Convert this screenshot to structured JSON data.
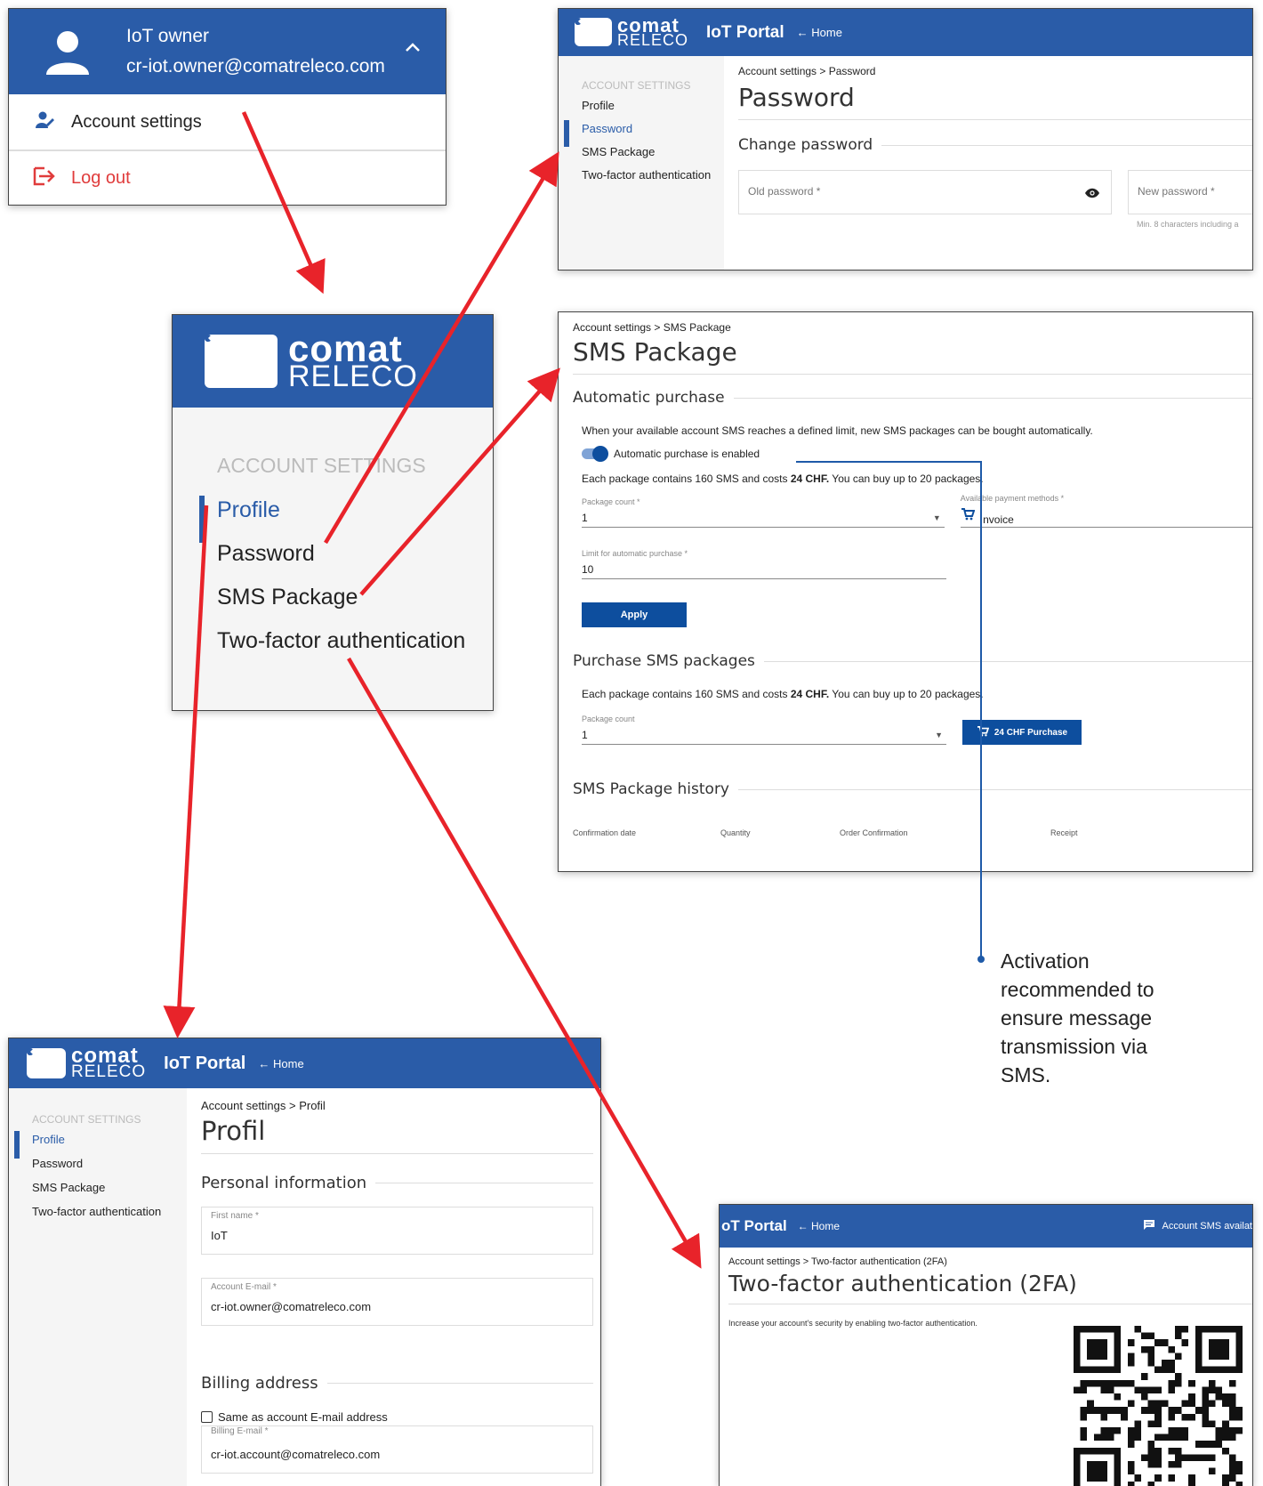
{
  "user_menu": {
    "user_name": "IoT owner",
    "user_email": "cr-iot.owner@comatreleco.com",
    "account_settings_label": "Account settings",
    "logout_label": "Log out"
  },
  "logo": {
    "line1": "comat",
    "line2": "RELECO"
  },
  "portal": {
    "title": "IoT Portal",
    "home_label": "Home"
  },
  "sidebar": {
    "heading": "ACCOUNT SETTINGS",
    "items": [
      "Profile",
      "Password",
      "SMS Package",
      "Two-factor authentication"
    ]
  },
  "password_page": {
    "breadcrumb": "Account settings > Password",
    "title": "Password",
    "section": "Change password",
    "old_password_placeholder": "Old password *",
    "new_password_placeholder": "New password *",
    "hint": "Min. 8 characters including a"
  },
  "sms_page": {
    "breadcrumb": "Account settings > SMS Package",
    "title": "SMS Package",
    "auto_section": "Automatic purchase",
    "auto_desc": "When your available account SMS reaches a defined limit, new SMS packages can be bought automatically.",
    "toggle_label": "Automatic purchase is enabled",
    "package_info_a": "Each package contains 160 SMS and costs ",
    "package_info_price": "24 CHF.",
    "package_info_b": " You can buy up to 20 packages.",
    "package_count_label": "Package count *",
    "package_count_value": "1",
    "payment_label": "Available payment methods *",
    "payment_value": "Invoice",
    "limit_label": "Limit for automatic purchase *",
    "limit_value": "10",
    "apply_label": "Apply",
    "purchase_section": "Purchase SMS packages",
    "purchase_count_label": "Package count",
    "purchase_count_value": "1",
    "purchase_button": "24 CHF Purchase",
    "history_section": "SMS Package history",
    "history_columns": [
      "Confirmation date",
      "Quantity",
      "Order Confirmation",
      "Receipt"
    ]
  },
  "callout": {
    "text": "Activation recommended to ensure message transmission via SMS."
  },
  "profile_page": {
    "breadcrumb": "Account settings > Profil",
    "title": "Profil",
    "personal_section": "Personal information",
    "first_name_label": "First name *",
    "first_name_value": "IoT",
    "email_label": "Account E-mail *",
    "email_value": "cr-iot.owner@comatreleco.com",
    "billing_section": "Billing address",
    "same_as_label": "Same as account E-mail address",
    "billing_email_label": "Billing E-mail *",
    "billing_email_value": "cr-iot.account@comatreleco.com"
  },
  "twofa_page": {
    "portal_title": "oT Portal",
    "sms_available": "Account SMS availat",
    "breadcrumb": "Account settings > Two-factor authentication (2FA)",
    "title": "Two-factor authentication (2FA)",
    "desc": "Increase your account's security by enabling two-factor authentication."
  },
  "colors": {
    "brand_blue": "#2a5ca8",
    "button_blue": "#0d4e9e",
    "arrow_red": "#e8232a",
    "logout_red": "#e03c3c"
  }
}
